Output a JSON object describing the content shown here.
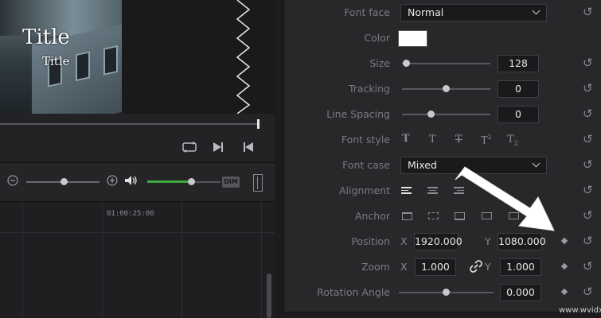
{
  "viewer": {
    "title_large": "Title",
    "title_small": "Title"
  },
  "timeline": {
    "timecode": "01:00:25:00"
  },
  "mixer": {
    "dim_label": "DIM",
    "zoom_level": 0.52,
    "volume_level": 0.6
  },
  "inspector": {
    "font_face": {
      "label": "Font face",
      "value": "Normal"
    },
    "color": {
      "label": "Color",
      "value": "#ffffff"
    },
    "size": {
      "label": "Size",
      "value": "128",
      "slider_level": 0.05
    },
    "tracking": {
      "label": "Tracking",
      "value": "0",
      "slider_level": 0.5
    },
    "line_spacing": {
      "label": "Line Spacing",
      "value": "0",
      "slider_level": 0.33
    },
    "font_style": {
      "label": "Font style"
    },
    "font_case": {
      "label": "Font case",
      "value": "Mixed"
    },
    "alignment": {
      "label": "Alignment"
    },
    "anchor": {
      "label": "Anchor"
    },
    "position": {
      "label": "Position",
      "x_label": "X",
      "x": "1920.000",
      "y_label": "Y",
      "y": "1080.000"
    },
    "zoom": {
      "label": "Zoom",
      "x_label": "X",
      "x": "1.000",
      "y_label": "Y",
      "y": "1.000"
    },
    "rotation_angle": {
      "label": "Rotation Angle",
      "value": "0.000",
      "slider_level": 0.5
    }
  },
  "icons": [
    "reset-icon",
    "chevron-down-icon",
    "link-icon",
    "keyframe-diamond-icon",
    "speaker-icon",
    "zoom-in-icon",
    "zoom-out-icon",
    "play-frame-icon",
    "go-to-end-icon",
    "loop-icon"
  ],
  "watermark": "www.wvidx.com"
}
